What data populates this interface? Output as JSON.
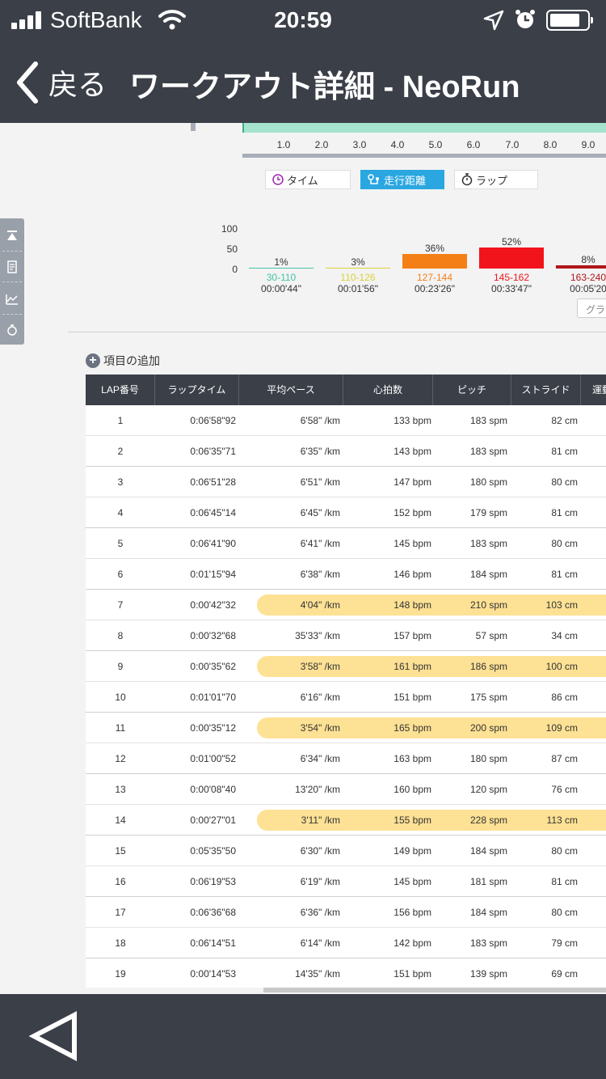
{
  "status_bar": {
    "carrier": "SoftBank",
    "time": "20:59"
  },
  "nav": {
    "back_label": "戻る",
    "title": "ワークアウト詳細 - NeoRun"
  },
  "distance_axis": {
    "ticks": [
      "1.0",
      "2.0",
      "3.0",
      "4.0",
      "5.0",
      "6.0",
      "7.0",
      "8.0",
      "9.0"
    ]
  },
  "graph_tabs": {
    "time": "タイム",
    "distance": "走行距離",
    "lap": "ラップ",
    "selected": "distance"
  },
  "zone_chart": {
    "y_ticks": [
      "100",
      "50",
      "0"
    ],
    "zones": [
      {
        "percent": "1%",
        "range": "30-110",
        "duration": "00:00'44\"",
        "value": 1,
        "color": "#43c4a4"
      },
      {
        "percent": "3%",
        "range": "110-126",
        "duration": "00:01'56\"",
        "value": 3,
        "color": "#d8d23a"
      },
      {
        "percent": "36%",
        "range": "127-144",
        "duration": "00:23'26\"",
        "value": 36,
        "color": "#f57f17"
      },
      {
        "percent": "52%",
        "range": "145-162",
        "duration": "00:33'47\"",
        "value": 52,
        "color": "#f2141b"
      },
      {
        "percent": "8%",
        "range": "163-240",
        "duration": "00:05'20",
        "value": 8,
        "color": "#b0161b"
      }
    ],
    "graph_button": "グラ"
  },
  "add_item_label": "項目の追加",
  "lap_table": {
    "columns": [
      "LAP番号",
      "ラップタイム",
      "平均ペース",
      "心拍数",
      "ピッチ",
      "ストライド",
      "運動"
    ],
    "rows": [
      [
        "1",
        "0:06'58\"92",
        "6'58\" /km",
        "133 bpm",
        "183 spm",
        "82 cm"
      ],
      [
        "2",
        "0:06'35\"71",
        "6'35\" /km",
        "143 bpm",
        "183 spm",
        "81 cm"
      ],
      [
        "3",
        "0:06'51\"28",
        "6'51\" /km",
        "147 bpm",
        "180 spm",
        "80 cm"
      ],
      [
        "4",
        "0:06'45\"14",
        "6'45\" /km",
        "152 bpm",
        "179 spm",
        "81 cm"
      ],
      [
        "5",
        "0:06'41\"90",
        "6'41\" /km",
        "145 bpm",
        "183 spm",
        "80 cm"
      ],
      [
        "6",
        "0:01'15\"94",
        "6'38\" /km",
        "146 bpm",
        "184 spm",
        "81 cm"
      ],
      [
        "7",
        "0:00'42\"32",
        "4'04\" /km",
        "148 bpm",
        "210 spm",
        "103 cm"
      ],
      [
        "8",
        "0:00'32\"68",
        "35'33\" /km",
        "157 bpm",
        "57 spm",
        "34 cm"
      ],
      [
        "9",
        "0:00'35\"62",
        "3'58\" /km",
        "161 bpm",
        "186 spm",
        "100 cm"
      ],
      [
        "10",
        "0:01'01\"70",
        "6'16\" /km",
        "151 bpm",
        "175 spm",
        "86 cm"
      ],
      [
        "11",
        "0:00'35\"12",
        "3'54\" /km",
        "165 bpm",
        "200 spm",
        "109 cm"
      ],
      [
        "12",
        "0:01'00\"52",
        "6'34\" /km",
        "163 bpm",
        "180 spm",
        "87 cm"
      ],
      [
        "13",
        "0:00'08\"40",
        "13'20\" /km",
        "160 bpm",
        "120 spm",
        "76 cm"
      ],
      [
        "14",
        "0:00'27\"01",
        "3'11\" /km",
        "155 bpm",
        "228 spm",
        "113 cm"
      ],
      [
        "15",
        "0:05'35\"50",
        "6'30\" /km",
        "149 bpm",
        "184 spm",
        "80 cm"
      ],
      [
        "16",
        "0:06'19\"53",
        "6'19\" /km",
        "145 bpm",
        "181 spm",
        "81 cm"
      ],
      [
        "17",
        "0:06'36\"68",
        "6'36\" /km",
        "156 bpm",
        "184 spm",
        "80 cm"
      ],
      [
        "18",
        "0:06'14\"51",
        "6'14\" /km",
        "142 bpm",
        "183 spm",
        "79 cm"
      ],
      [
        "19",
        "0:00'14\"53",
        "14'35\" /km",
        "151 bpm",
        "139 spm",
        "69 cm"
      ]
    ],
    "highlighted_laps": [
      "7",
      "9",
      "11",
      "14"
    ],
    "highlight_color": "#fcc83c"
  }
}
